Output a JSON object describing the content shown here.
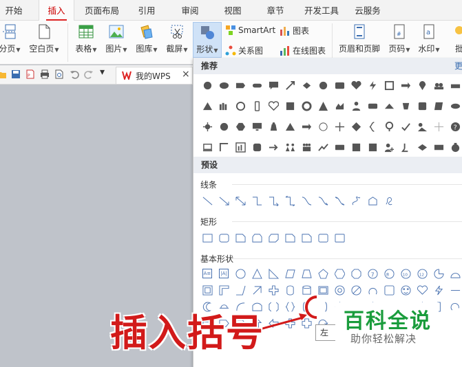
{
  "menu": {
    "tabs": [
      "开始",
      "插入",
      "页面布局",
      "引用",
      "审阅",
      "视图",
      "章节",
      "开发工具",
      "云服务"
    ],
    "active_index": 1
  },
  "ribbon": {
    "page_break": "分页",
    "blank_page": "空白页",
    "table": "表格",
    "picture": "图片",
    "gallery": "图库",
    "screenshot": "截屏",
    "shape": "形状",
    "smartart": "SmartArt",
    "chart": "图表",
    "relation_chart": "关系图",
    "online_chart": "在线图表",
    "header_footer": "页眉和页脚",
    "page_number": "页码",
    "watermark": "水印",
    "batch": "批"
  },
  "quickbar": {
    "doc_tab": "我的WPS",
    "close": "×"
  },
  "panel": {
    "recommended": "推荐",
    "more": "更",
    "preset": "预设",
    "lines": "线条",
    "rectangles": "矩形",
    "basic_shapes": "基本形状",
    "basic_text_icons": [
      "A≡",
      "|A|"
    ]
  },
  "overlay": {
    "label": "插入括号",
    "tooltip": "左",
    "watermark_title": "百科全说",
    "watermark_sub": "助你轻松解决"
  },
  "colors": {
    "accent_red": "#d21a1a",
    "shape_fill": "#555555",
    "line_blue": "#4a72b0",
    "watermark_green": "#1a9c3c"
  }
}
